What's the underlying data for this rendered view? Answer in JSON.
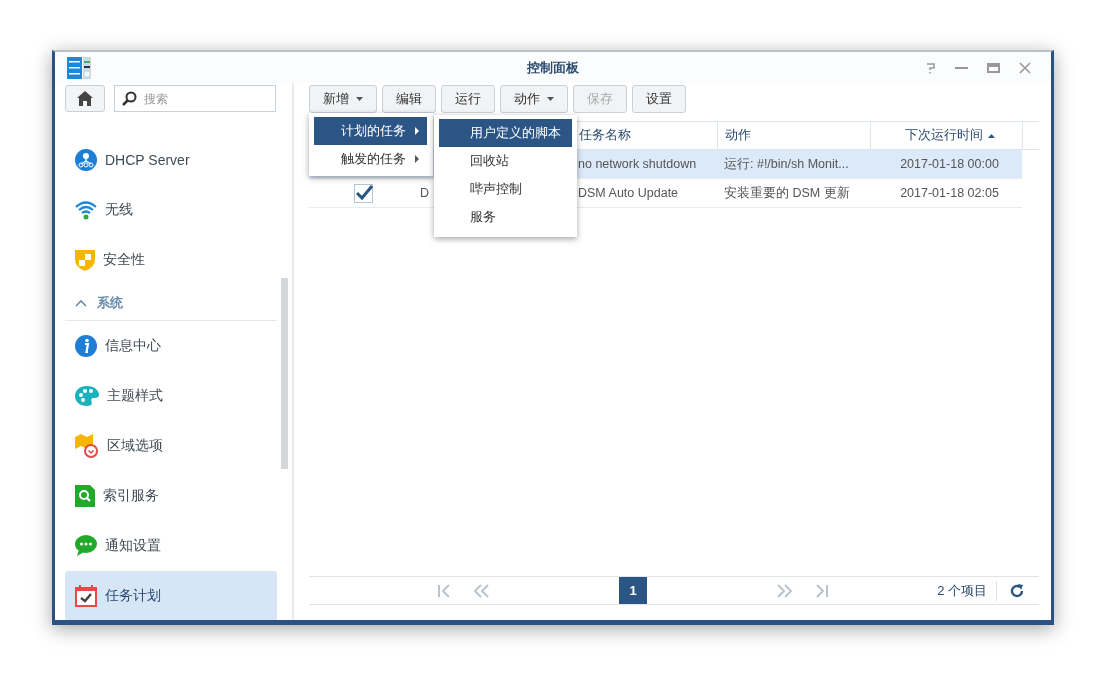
{
  "window": {
    "title": "控制面板"
  },
  "sidebar": {
    "search": {
      "placeholder": "搜索"
    },
    "items": [
      {
        "kind": "item",
        "label": "DHCP Server",
        "selected": false
      },
      {
        "kind": "item",
        "label": "无线",
        "selected": false
      },
      {
        "kind": "item",
        "label": "安全性",
        "selected": false
      },
      {
        "kind": "section",
        "label": "系统",
        "expanded": true
      },
      {
        "kind": "item",
        "label": "信息中心",
        "selected": false
      },
      {
        "kind": "item",
        "label": "主题样式",
        "selected": false
      },
      {
        "kind": "item",
        "label": "区域选项",
        "selected": false
      },
      {
        "kind": "item",
        "label": "索引服务",
        "selected": false
      },
      {
        "kind": "item",
        "label": "通知设置",
        "selected": false
      },
      {
        "kind": "item",
        "label": "任务计划",
        "selected": true
      }
    ]
  },
  "toolbar": [
    {
      "label": "新增",
      "dropdown": true,
      "disabled": false
    },
    {
      "label": "编辑",
      "dropdown": false,
      "disabled": false
    },
    {
      "label": "运行",
      "dropdown": false,
      "disabled": false
    },
    {
      "label": "动作",
      "dropdown": true,
      "disabled": false
    },
    {
      "label": "保存",
      "dropdown": false,
      "disabled": true
    },
    {
      "label": "设置",
      "dropdown": false,
      "disabled": false
    }
  ],
  "menu": {
    "items": [
      {
        "label": "计划的任务",
        "selected": true
      },
      {
        "label": "触发的任务",
        "selected": false
      }
    ],
    "submenu": [
      {
        "label": "用户定义的脚本",
        "selected": true
      },
      {
        "label": "回收站",
        "selected": false
      },
      {
        "label": "哔声控制",
        "selected": false
      },
      {
        "label": "服务",
        "selected": false
      }
    ]
  },
  "table": {
    "columns": [
      {
        "label": "任务名称",
        "sorted": false
      },
      {
        "label": "动作",
        "sorted": false
      },
      {
        "label": "下次运行时间",
        "sorted": true
      }
    ],
    "rows": [
      {
        "selected": true,
        "name": "no network shutdown",
        "action": "运行: #!/bin/sh Monit...",
        "next_run": "2017-01-18 00:00"
      },
      {
        "selected": false,
        "checked": true,
        "column_2": "D",
        "name": "DSM Auto Update",
        "action": "安装重要的 DSM 更新",
        "next_run": "2017-01-18 02:05"
      }
    ]
  },
  "pager": {
    "pages": [
      {
        "label": "1",
        "selected": true
      }
    ],
    "count": "2 个项目"
  }
}
